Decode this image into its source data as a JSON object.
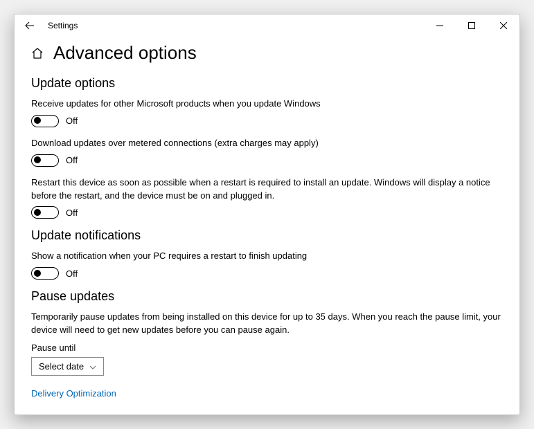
{
  "app": {
    "title": "Settings"
  },
  "page": {
    "heading": "Advanced options"
  },
  "sections": {
    "update_options": {
      "title": "Update options",
      "items": [
        {
          "label": "Receive updates for other Microsoft products when you update Windows",
          "state": "Off"
        },
        {
          "label": "Download updates over metered connections (extra charges may apply)",
          "state": "Off"
        },
        {
          "label": "Restart this device as soon as possible when a restart is required to install an update. Windows will display a notice before the restart, and the device must be on and plugged in.",
          "state": "Off"
        }
      ]
    },
    "update_notifications": {
      "title": "Update notifications",
      "items": [
        {
          "label": "Show a notification when your PC requires a restart to finish updating",
          "state": "Off"
        }
      ]
    },
    "pause_updates": {
      "title": "Pause updates",
      "description": "Temporarily pause updates from being installed on this device for up to 35 days. When you reach the pause limit, your device will need to get new updates before you can pause again.",
      "field_label": "Pause until",
      "dropdown_value": "Select date"
    }
  },
  "links": {
    "delivery_optimization": "Delivery Optimization"
  }
}
